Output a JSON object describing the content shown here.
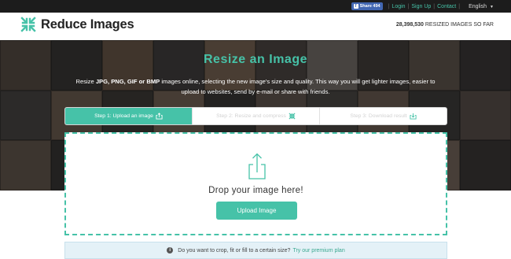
{
  "topbar": {
    "facebook_share": "Share 494",
    "login": "Login",
    "signup": "Sign Up",
    "contact": "Contact",
    "language": "English"
  },
  "header": {
    "logo_text": "Reduce Images",
    "counter_number": "28,398,530",
    "counter_label": "RESIZED IMAGES SO FAR"
  },
  "hero": {
    "title": "Resize an Image",
    "desc_1": "Resize ",
    "desc_formats": "JPG, PNG, GIF or BMP",
    "desc_2": " images online, selecting the new image's size and quality. This way you will get lighter images, easier to upload to websites, send by e-mail or share with friends."
  },
  "steps": [
    {
      "label": "Step 1: Upload an image",
      "icon": "upload-icon"
    },
    {
      "label": "Step 2: Resize and compress",
      "icon": "compress-icon"
    },
    {
      "label": "Step 3: Download result",
      "icon": "download-icon"
    }
  ],
  "dropzone": {
    "text": "Drop your image here!",
    "button": "Upload Image"
  },
  "notice": {
    "text": "Do you want to crop, fit or fill to a certain size?",
    "link": "Try our premium plan"
  },
  "colors": {
    "accent": "#46c2a8",
    "topbar": "#1c1c1c",
    "facebook": "#4267b2"
  }
}
